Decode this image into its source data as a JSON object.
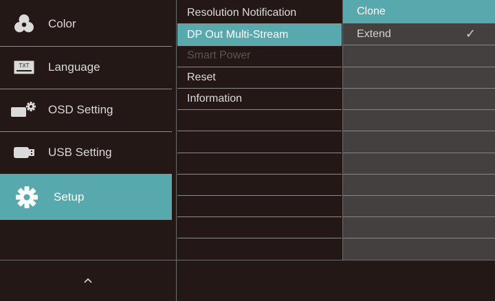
{
  "main_menu": {
    "items": [
      {
        "label": "Color",
        "icon": "color-icon"
      },
      {
        "label": "Language",
        "icon": "language-icon",
        "icon_text": "TXT"
      },
      {
        "label": "OSD Setting",
        "icon": "osd-setting-icon"
      },
      {
        "label": "USB Setting",
        "icon": "usb-icon"
      },
      {
        "label": "Setup",
        "icon": "gear-icon",
        "active": true
      }
    ]
  },
  "submenu": {
    "items": [
      {
        "label": "Resolution Notification"
      },
      {
        "label": "DP Out Multi-Stream",
        "active": true
      },
      {
        "label": "Smart Power",
        "disabled": true
      },
      {
        "label": "Reset"
      },
      {
        "label": "Information"
      }
    ]
  },
  "options": {
    "items": [
      {
        "label": "Clone",
        "active": true
      },
      {
        "label": "Extend",
        "checked": true,
        "check_glyph": "✓"
      }
    ]
  },
  "footer": {
    "up_arrow_icon": "chevron-up-icon"
  },
  "colors": {
    "background": "#231815",
    "accent": "#58a9ad",
    "options_panel": "#444040",
    "disabled_text": "#5e5450"
  }
}
